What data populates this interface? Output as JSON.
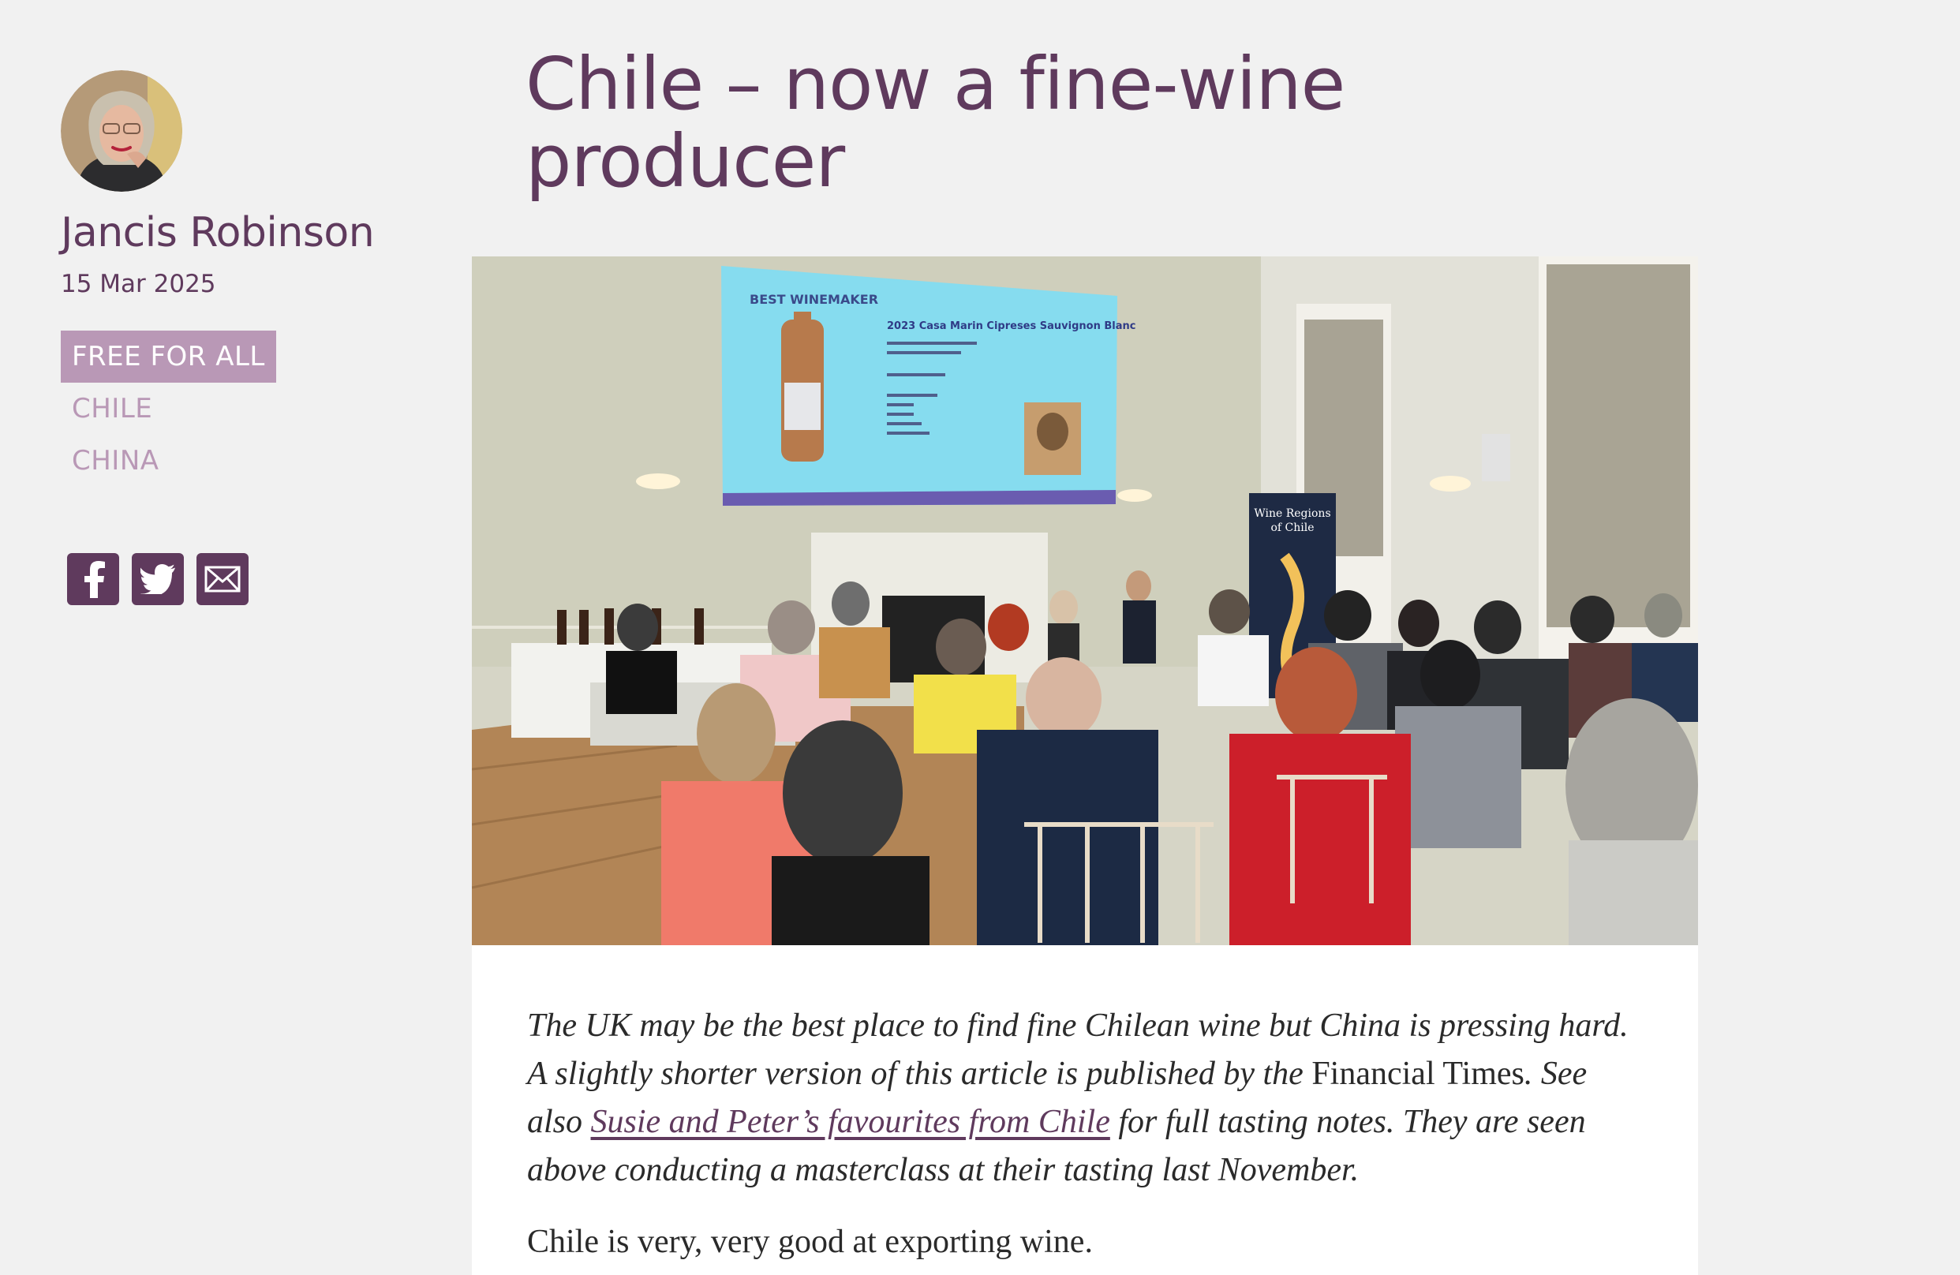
{
  "author": {
    "name": "Jancis Robinson",
    "date": "15 Mar 2025"
  },
  "tags": [
    {
      "label": "FREE FOR ALL"
    },
    {
      "label": "CHILE"
    },
    {
      "label": "CHINA"
    }
  ],
  "social": {
    "icons": [
      "facebook-icon",
      "twitter-icon",
      "email-icon"
    ]
  },
  "article": {
    "title": "Chile – now a fine-wine producer",
    "hero": {
      "slide_heading": "BEST WINEMAKER",
      "slide_wine": "2023 Casa Marin Cipreses Sauvignon Blanc",
      "banner_line1": "Wine Regions",
      "banner_line2": "of Chile"
    },
    "standfirst": {
      "part1": "The UK may be the best place to find fine Chilean wine but China is pressing hard. A slightly shorter version of this article is published by the ",
      "publication": "Financial Times",
      "part2": ". See also ",
      "link_text": "Susie and Peter’s favourites from Chile",
      "part3": " for full tasting notes. They are seen above conducting a masterclass at their tasting last November."
    },
    "lead": "Chile is very, very good at exporting wine."
  },
  "colors": {
    "brand": "#5f3a5d",
    "tag": "#b998b6",
    "page_bg": "#f1f1f1"
  }
}
